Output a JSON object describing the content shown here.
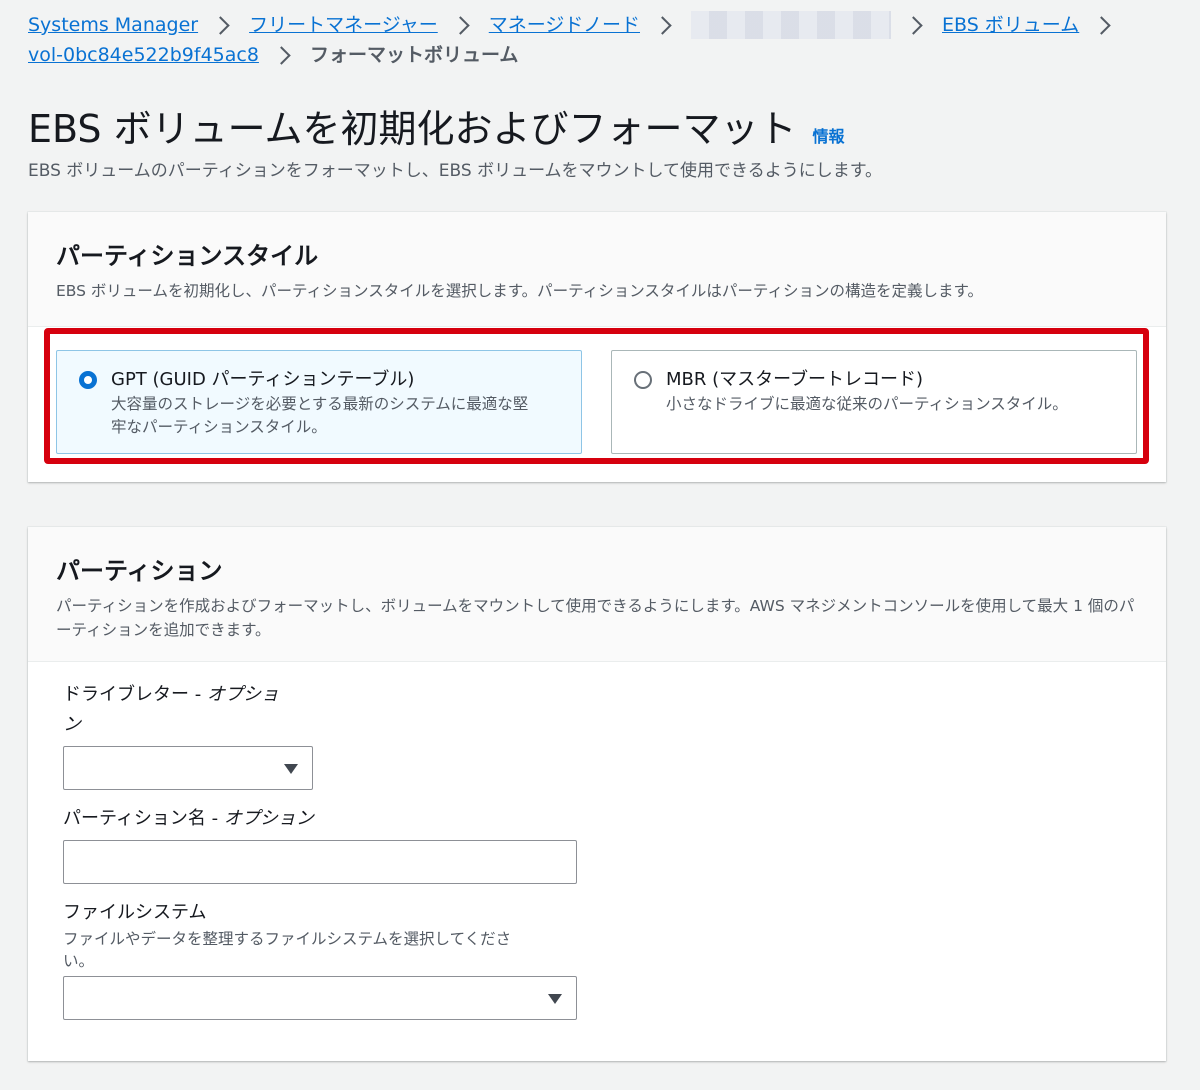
{
  "breadcrumb": {
    "items": [
      "Systems Manager",
      "フリートマネージャー",
      "マネージドノード",
      "",
      "EBS ボリューム",
      "vol-0bc84e522b9f45ac8",
      "フォーマットボリューム"
    ]
  },
  "header": {
    "title": "EBS ボリュームを初期化およびフォーマット",
    "info": "情報",
    "description": "EBS ボリュームのパーティションをフォーマットし、EBS ボリュームをマウントして使用できるようにします。"
  },
  "partition_style": {
    "title": "パーティションスタイル",
    "description": "EBS ボリュームを初期化し、パーティションスタイルを選択します。パーティションスタイルはパーティションの構造を定義します。",
    "options": [
      {
        "label": "GPT (GUID パーティションテーブル)",
        "description_line1": "大容量のストレージを必要とする最新のシステムに最適な堅",
        "description_line2": "牢なパーティションスタイル。",
        "selected": true
      },
      {
        "label": "MBR (マスターブートレコード)",
        "description_line1": "小さなドライブに最適な従来のパーティションスタイル。",
        "description_line2": "",
        "selected": false
      }
    ],
    "highlight_color": "#d6000e"
  },
  "partition": {
    "title": "パーティション",
    "description": "パーティションを作成およびフォーマットし、ボリュームをマウントして使用できるようにします。AWS マネジメントコンソールを使用して最大 1 個のパーティションを追加できます。",
    "drive_letter": {
      "label_main": "ドライブレター - ",
      "label_optional_1": "オプショ",
      "label_optional_2": "ン",
      "value": ""
    },
    "partition_name": {
      "label_main": "パーティション名 - ",
      "label_optional": "オプション",
      "value": ""
    },
    "file_system": {
      "label": "ファイルシステム",
      "help_line1": "ファイルやデータを整理するファイルシステムを選択してくださ",
      "help_line2": "い。",
      "value": ""
    }
  },
  "colors": {
    "link": "#0972d3",
    "selected_tile_bg": "#f1faff",
    "page_bg": "#f2f3f3"
  }
}
